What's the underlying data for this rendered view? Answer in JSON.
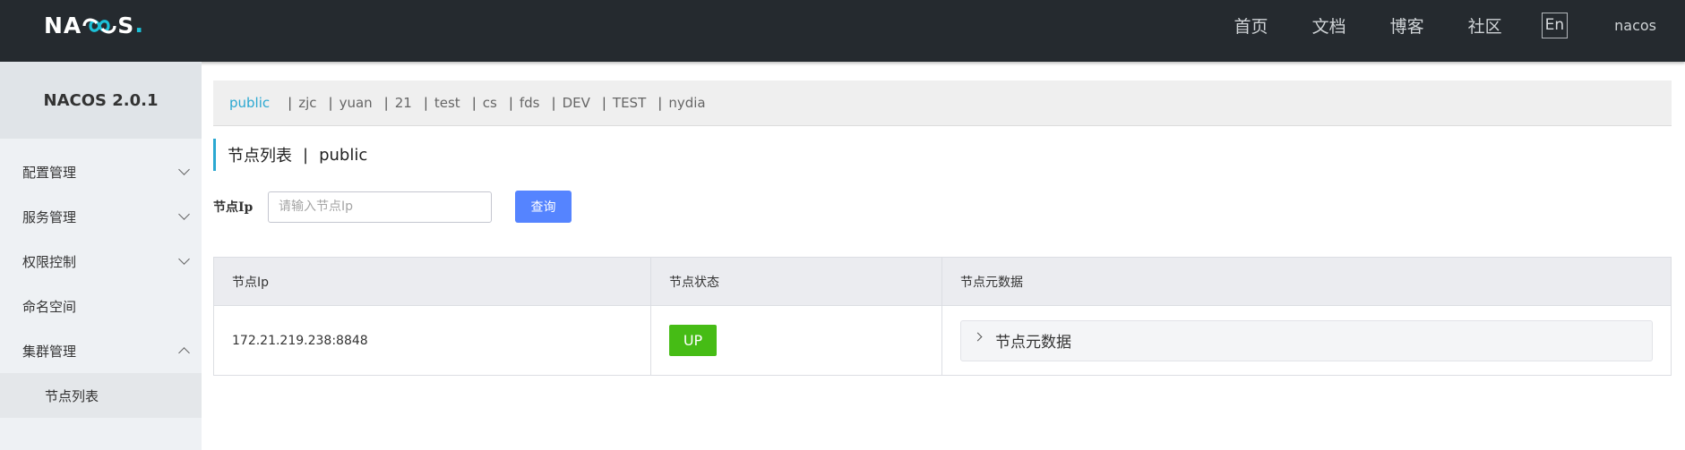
{
  "header": {
    "logo_left": "NA",
    "logo_right": "S",
    "logo_dot": ".",
    "nav": [
      "首页",
      "文档",
      "博客",
      "社区"
    ],
    "lang_toggle": "En",
    "user": "nacos"
  },
  "sidebar": {
    "title": "NACOS 2.0.1",
    "items": [
      {
        "label": "配置管理",
        "chevron": "down"
      },
      {
        "label": "服务管理",
        "chevron": "down"
      },
      {
        "label": "权限控制",
        "chevron": "down"
      },
      {
        "label": "命名空间"
      },
      {
        "label": "集群管理",
        "chevron": "up"
      }
    ],
    "sub_items": [
      {
        "label": "节点列表"
      }
    ]
  },
  "namespaces": {
    "active": "public",
    "others": [
      "zjc",
      "yuan",
      "21",
      "test",
      "cs",
      "fds",
      "DEV",
      "TEST",
      "nydia"
    ],
    "separator": "|"
  },
  "page": {
    "title": "节点列表",
    "separator": "|",
    "namespace": "public"
  },
  "search": {
    "label": "节点Ip",
    "placeholder": "请输入节点Ip",
    "button": "查询"
  },
  "table": {
    "headers": [
      "节点Ip",
      "节点状态",
      "节点元数据"
    ],
    "rows": [
      {
        "ip": "172.21.219.238:8848",
        "status": "UP",
        "metadata_label": "节点元数据"
      }
    ]
  },
  "colors": {
    "header_bg": "#252a2f",
    "accent": "#2ba8d1",
    "primary_button": "#5584ff",
    "status_up": "#46bc15"
  }
}
